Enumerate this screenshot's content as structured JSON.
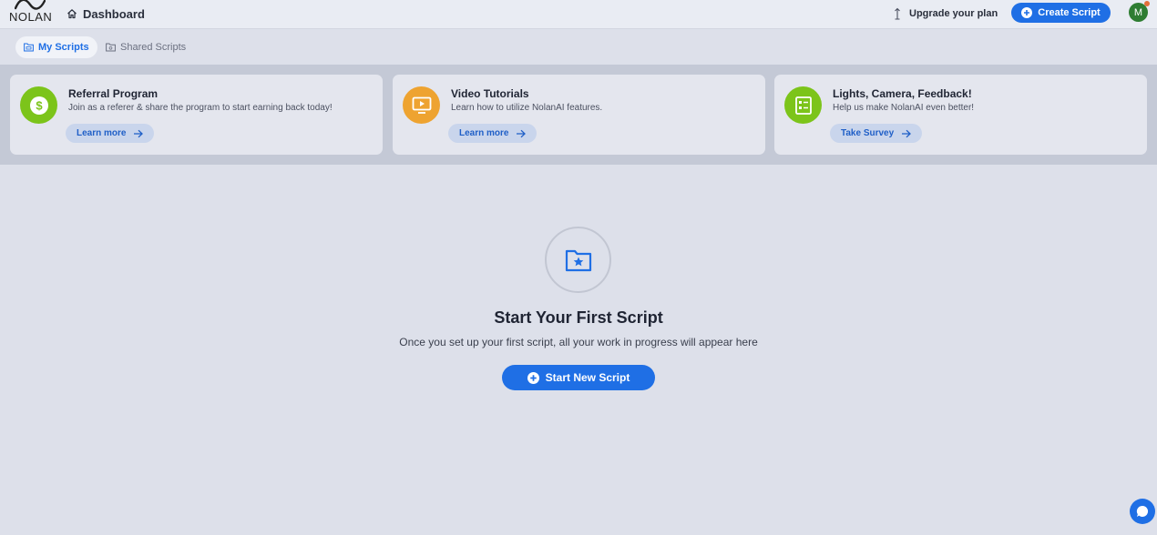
{
  "header": {
    "logo_text": "NOLAN",
    "breadcrumb": "Dashboard",
    "upgrade_label": "Upgrade your plan",
    "create_label": "Create Script",
    "avatar_initial": "M"
  },
  "tabs": [
    {
      "label": "My Scripts",
      "active": true
    },
    {
      "label": "Shared Scripts",
      "active": false
    }
  ],
  "cards": [
    {
      "title": "Referral Program",
      "description": "Join as a referer & share the program to start earning back today!",
      "button": "Learn more",
      "icon": "dollar-icon",
      "color": "#7cc41a"
    },
    {
      "title": "Video Tutorials",
      "description": "Learn how to utilize NolanAI features.",
      "button": "Learn more",
      "icon": "play-screen-icon",
      "color": "#eea330"
    },
    {
      "title": "Lights, Camera, Feedback!",
      "description": "Help us make NolanAI even better!",
      "button": "Take Survey",
      "icon": "survey-icon",
      "color": "#7cc41a"
    }
  ],
  "empty_state": {
    "icon": "star-folder-icon",
    "title": "Start Your First Script",
    "subtitle": "Once you set up your first script, all your work in progress will appear here",
    "button": "Start New Script"
  },
  "colors": {
    "accent": "#1f6fe5",
    "background": "#dde0ea",
    "band": "#c4c9d6"
  }
}
